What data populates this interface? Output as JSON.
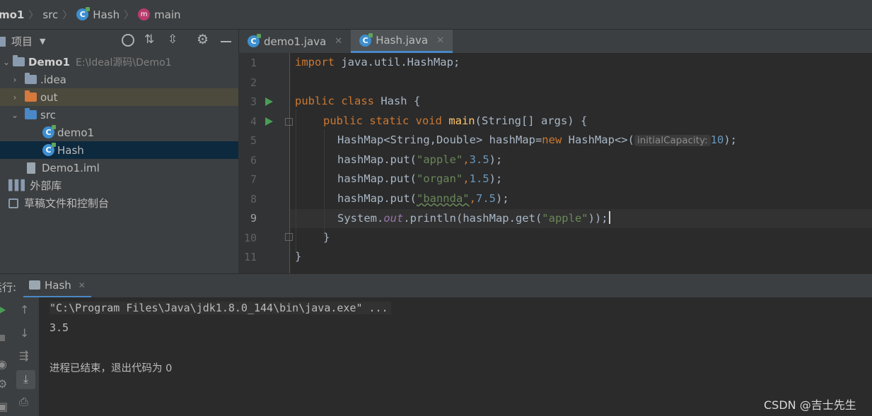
{
  "breadcrumb": {
    "project": "mo1",
    "folder": "src",
    "class": "Hash",
    "method": "main"
  },
  "project_panel": {
    "title": "项目",
    "tree": [
      {
        "label": "Demo1",
        "hint": "E:\\Ideal源码\\Demo1"
      },
      {
        "label": ".idea"
      },
      {
        "label": "out"
      },
      {
        "label": "src"
      },
      {
        "label": "demo1"
      },
      {
        "label": "Hash"
      },
      {
        "label": "Demo1.iml"
      },
      {
        "label": "外部库"
      },
      {
        "label": "草稿文件和控制台"
      }
    ]
  },
  "tabs": [
    {
      "label": "demo1.java"
    },
    {
      "label": "Hash.java"
    }
  ],
  "editor": {
    "line_numbers": [
      "1",
      "2",
      "3",
      "4",
      "5",
      "6",
      "7",
      "8",
      "9",
      "10",
      "11"
    ],
    "current_line": "9",
    "param_hint": "initialCapacity:",
    "code": {
      "l1_kw": "import",
      "l1_rest": " java.util.HashMap;",
      "l3_kw": "public class",
      "l3_rest": " Hash {",
      "l4_kw": "public static void",
      "l4_fn": " main",
      "l4_rest": "(String[] args) {",
      "l5_a": "HashMap<String,Double> hashMap=",
      "l5_kw": "new",
      "l5_b": " HashMap<>(",
      "l5_num": "10",
      "l5_c": ");",
      "put_prefix": "hashMap.put(",
      "l6_str": "\"apple\"",
      "l6_num": "3.5",
      "l7_str": "\"organ\"",
      "l7_num": "1.5",
      "l8_str": "\"bannda\"",
      "l8_num": "7.5",
      "comma": ",",
      "put_suffix": ");",
      "l9_a": "System.",
      "l9_out": "out",
      "l9_b": ".println(hashMap.get(",
      "l9_str": "\"apple\"",
      "l9_c": "));",
      "l10": "}",
      "l11": "}"
    }
  },
  "run_panel": {
    "label": "运行:",
    "tab": "Hash",
    "console": [
      "\"C:\\Program Files\\Java\\jdk1.8.0_144\\bin\\java.exe\" ...",
      "3.5",
      "",
      "进程已结束，退出代码为 0"
    ]
  },
  "watermark": "CSDN @吉士先生"
}
